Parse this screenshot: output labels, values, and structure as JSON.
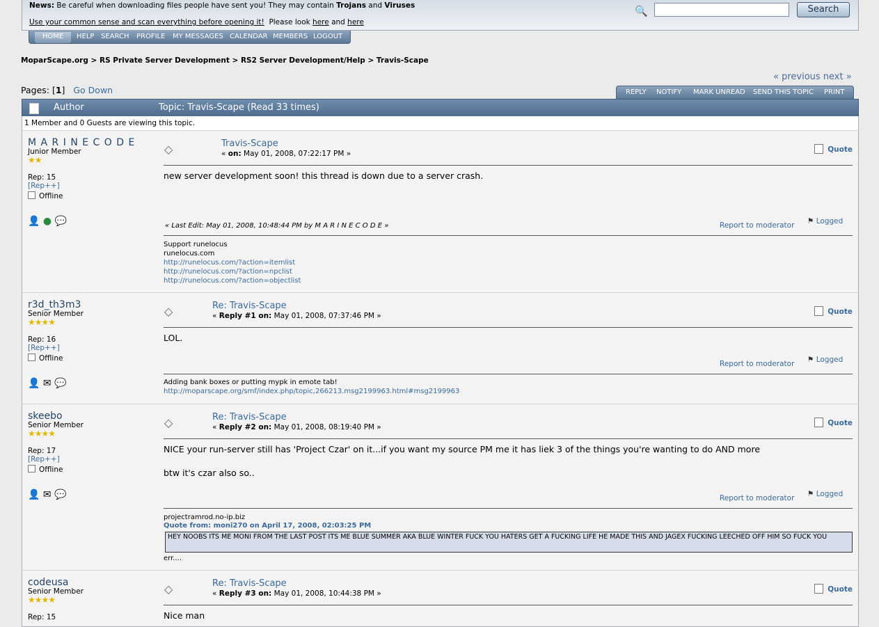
{
  "news": {
    "label": "News:",
    "line1_a": "Be careful when downloading files people have sent you!  They may contain",
    "trojans": "Trojans",
    "and": "and",
    "viruses": "Viruses",
    "line2_link": "Use your common sense and scan everything before opening it!",
    "line2_text": "Please look",
    "here1": "here",
    "and2": "and",
    "here2": "here"
  },
  "search": {
    "button": "Search",
    "value": ""
  },
  "menu": [
    "HOME",
    "HELP",
    "SEARCH",
    "PROFILE",
    "MY MESSAGES",
    "CALENDAR",
    "MEMBERS",
    "LOGOUT"
  ],
  "breadcrumb": [
    "MoparScape.org",
    "RS Private Server Development",
    "RS2 Server Development/Help",
    "Travis-Scape"
  ],
  "breadcrumb_sep": ">",
  "pages": {
    "label": "Pages: [",
    "current": "1",
    "close": "]",
    "go_down": "Go Down"
  },
  "prevnext": "« previous next »",
  "topic_buttons": [
    "REPLY",
    "NOTIFY",
    "MARK UNREAD",
    "SEND THIS TOPIC",
    "PRINT"
  ],
  "header": {
    "author": "Author",
    "topic": "Topic: Travis-Scape  (Read 33 times)"
  },
  "viewing": "1 Member and 0 Guests are viewing this topic.",
  "common": {
    "quote": "Quote",
    "report": "Report to moderator",
    "logged": "Logged",
    "offline": "Offline",
    "rep_btn": "[Rep++]"
  },
  "posts": [
    {
      "author": "M A R I N E C O D E",
      "rank": "Junior Member",
      "stars": "★★",
      "rep": "Rep: 15",
      "title": "Travis-Scape",
      "meta_prefix": "«",
      "meta_bold": "on:",
      "meta_date": "May 01, 2008, 07:22:17 PM »",
      "body": "new server development soon! this thread is down due to a server crash.",
      "last_edit": "« Last Edit: May 01, 2008, 10:48:44 PM by M A R I N E C O D E »",
      "sig": [
        "Support runelocus",
        "runelocus.com"
      ],
      "sig_links": [
        "http://runelocus.com/?action=itemlist",
        "http://runelocus.com/?action=npclist",
        "http://runelocus.com/?action=objectlist"
      ]
    },
    {
      "author": "r3d_th3m3",
      "rank": "Senior Member",
      "stars": "★★★★",
      "rep": "Rep: 16",
      "title": "Re: Travis-Scape",
      "meta_prefix": "«",
      "meta_bold": "Reply #1 on:",
      "meta_date": "May 01, 2008, 07:37:46 PM »",
      "body": "LOL.",
      "sig": [
        "Adding bank boxes or putting mypk in emote tab!"
      ],
      "sig_links": [
        "http://moparscape.org/smf/index.php/topic,266213.msg2199963.html#msg2199963"
      ]
    },
    {
      "author": "skeebo",
      "rank": "Senior Member",
      "stars": "★★★★",
      "rep": "Rep: 17",
      "title": "Re: Travis-Scape",
      "meta_prefix": "«",
      "meta_bold": "Reply #2 on:",
      "meta_date": "May 01, 2008, 08:19:40 PM »",
      "body": "NICE your run-server still has 'Project Czar' on it...if you want my source PM me it has liek 3 of the things you're wanting to do AND more",
      "body2": "btw it's czar also so..",
      "sig": [
        "projectramrod.no-ip.biz"
      ],
      "quote_from": "Quote from: moni270 on April 17, 2008, 02:03:25 PM",
      "quote_text": "HEY NOOBS ITS ME MONI FROM THE LAST POST ITS ME BLUE SUMMER AKA BLUE WINTER FUCK YOU HATERS GET  A FUCKING LIFE HE MADE THIS AND JAGEX FUCKING LEECHED OFF HIM SO FUCK YOU",
      "after_quote": "err...."
    },
    {
      "author": "codeusa",
      "rank": "Senior Member",
      "stars": "★★★★",
      "rep": "Rep: 15",
      "title": "Re: Travis-Scape",
      "meta_prefix": "«",
      "meta_bold": "Reply #3 on:",
      "meta_date": "May 01, 2008, 10:44:38 PM »",
      "body": "Nice man"
    }
  ]
}
